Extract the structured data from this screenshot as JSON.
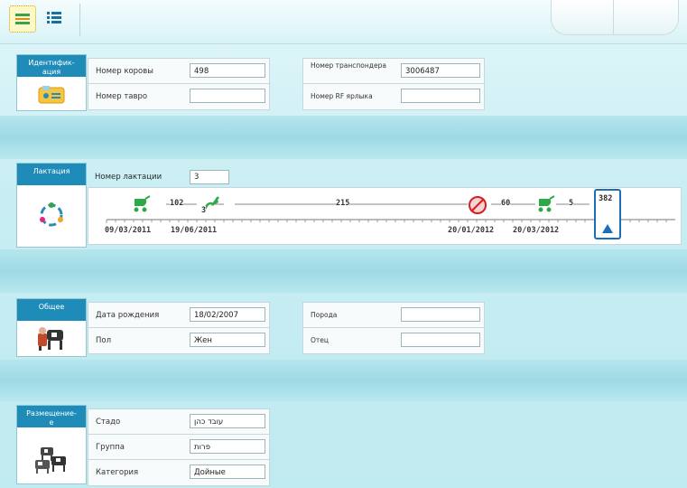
{
  "sections": {
    "ident": {
      "title": "Идентифик-\nация",
      "fields": {
        "cow_number_label": "Номер коровы",
        "cow_number": "498",
        "brand_number_label": "Номер тавро",
        "brand_number": "",
        "transponder_label": "Номер транспондера",
        "transponder": "3006487",
        "rf_tag_label": "Номер RF ярлыка",
        "rf_tag": ""
      }
    },
    "lactation": {
      "title": "Лактация",
      "number_label": "Номер лактации",
      "number": "3",
      "timeline": {
        "seg1": "102",
        "seg2": "3",
        "seg3": "215",
        "seg4": "60",
        "seg5": "5",
        "current": "382",
        "date1": "09/03/2011",
        "date2": "19/06/2011",
        "date3": "20/01/2012",
        "date4": "20/03/2012"
      }
    },
    "general": {
      "title": "Общее",
      "birth_date_label": "Дата рождения",
      "birth_date": "18/02/2007",
      "sex_label": "Пол",
      "sex": "Жен",
      "breed_label": "Порода",
      "breed": "",
      "father_label": "Отец",
      "father": ""
    },
    "placement": {
      "title": "Размещение-\nе",
      "herd_label": "Стадо",
      "herd": "עובד כהן",
      "group_label": "Группа",
      "group": "פרות",
      "category_label": "Категория",
      "category": "Дойные"
    }
  },
  "icons": [
    "grid-view-icon",
    "list-view-icon",
    "id-card-icon",
    "lactation-cycle-icon",
    "cows-icon",
    "cow-group-icon",
    "stroller-icon",
    "dry-off-icon",
    "current-position-icon"
  ]
}
